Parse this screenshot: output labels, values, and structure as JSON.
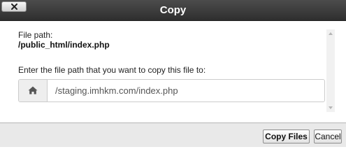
{
  "dialog": {
    "title": "Copy",
    "close_icon": "close-icon"
  },
  "content": {
    "file_path_label": "File path:",
    "file_path_value": "/public_html/index.php",
    "instruction": "Enter the file path that you want to copy this file to:",
    "path_input": {
      "value": "/staging.imhkm.com/index.php",
      "addon_icon": "home-icon"
    }
  },
  "footer": {
    "copy_label": "Copy Files",
    "cancel_label": "Cancel"
  }
}
